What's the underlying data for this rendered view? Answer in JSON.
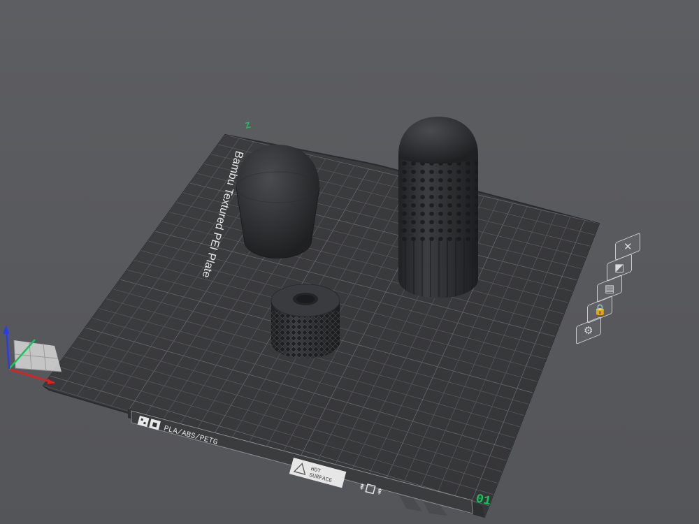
{
  "plate": {
    "name": "Bambu Textured PEI Plate",
    "number": "01",
    "material_label": "PLA/ABS/PETG",
    "hot_line1": "HOT",
    "hot_line2": "SURFACE",
    "axis_label": "Z"
  },
  "plate_toolbar": [
    {
      "id": "close",
      "icon": "close-icon",
      "glyph": "✕"
    },
    {
      "id": "auto-orient",
      "icon": "auto-orient-icon",
      "glyph": "◩"
    },
    {
      "id": "arrange",
      "icon": "arrange-icon",
      "glyph": "▤"
    },
    {
      "id": "lock",
      "icon": "lock-icon",
      "glyph": "🔒"
    },
    {
      "id": "settings",
      "icon": "gear-icon",
      "glyph": "⚙"
    }
  ],
  "objects": [
    {
      "id": "dome-cap",
      "shape": "dome"
    },
    {
      "id": "dimpled-tube",
      "shape": "tall-cylinder"
    },
    {
      "id": "knurled-nut",
      "shape": "short-cylinder"
    }
  ],
  "colors": {
    "background": "#5a5b5e",
    "plate": "#3a3b3d",
    "grid": "#55565a",
    "label_text": "#e6e6e6",
    "plate_number": "#18c35c",
    "axis_x": "#e02020",
    "axis_y": "#18c35c",
    "axis_z": "#2b3cf0",
    "object": "#2f3032"
  }
}
